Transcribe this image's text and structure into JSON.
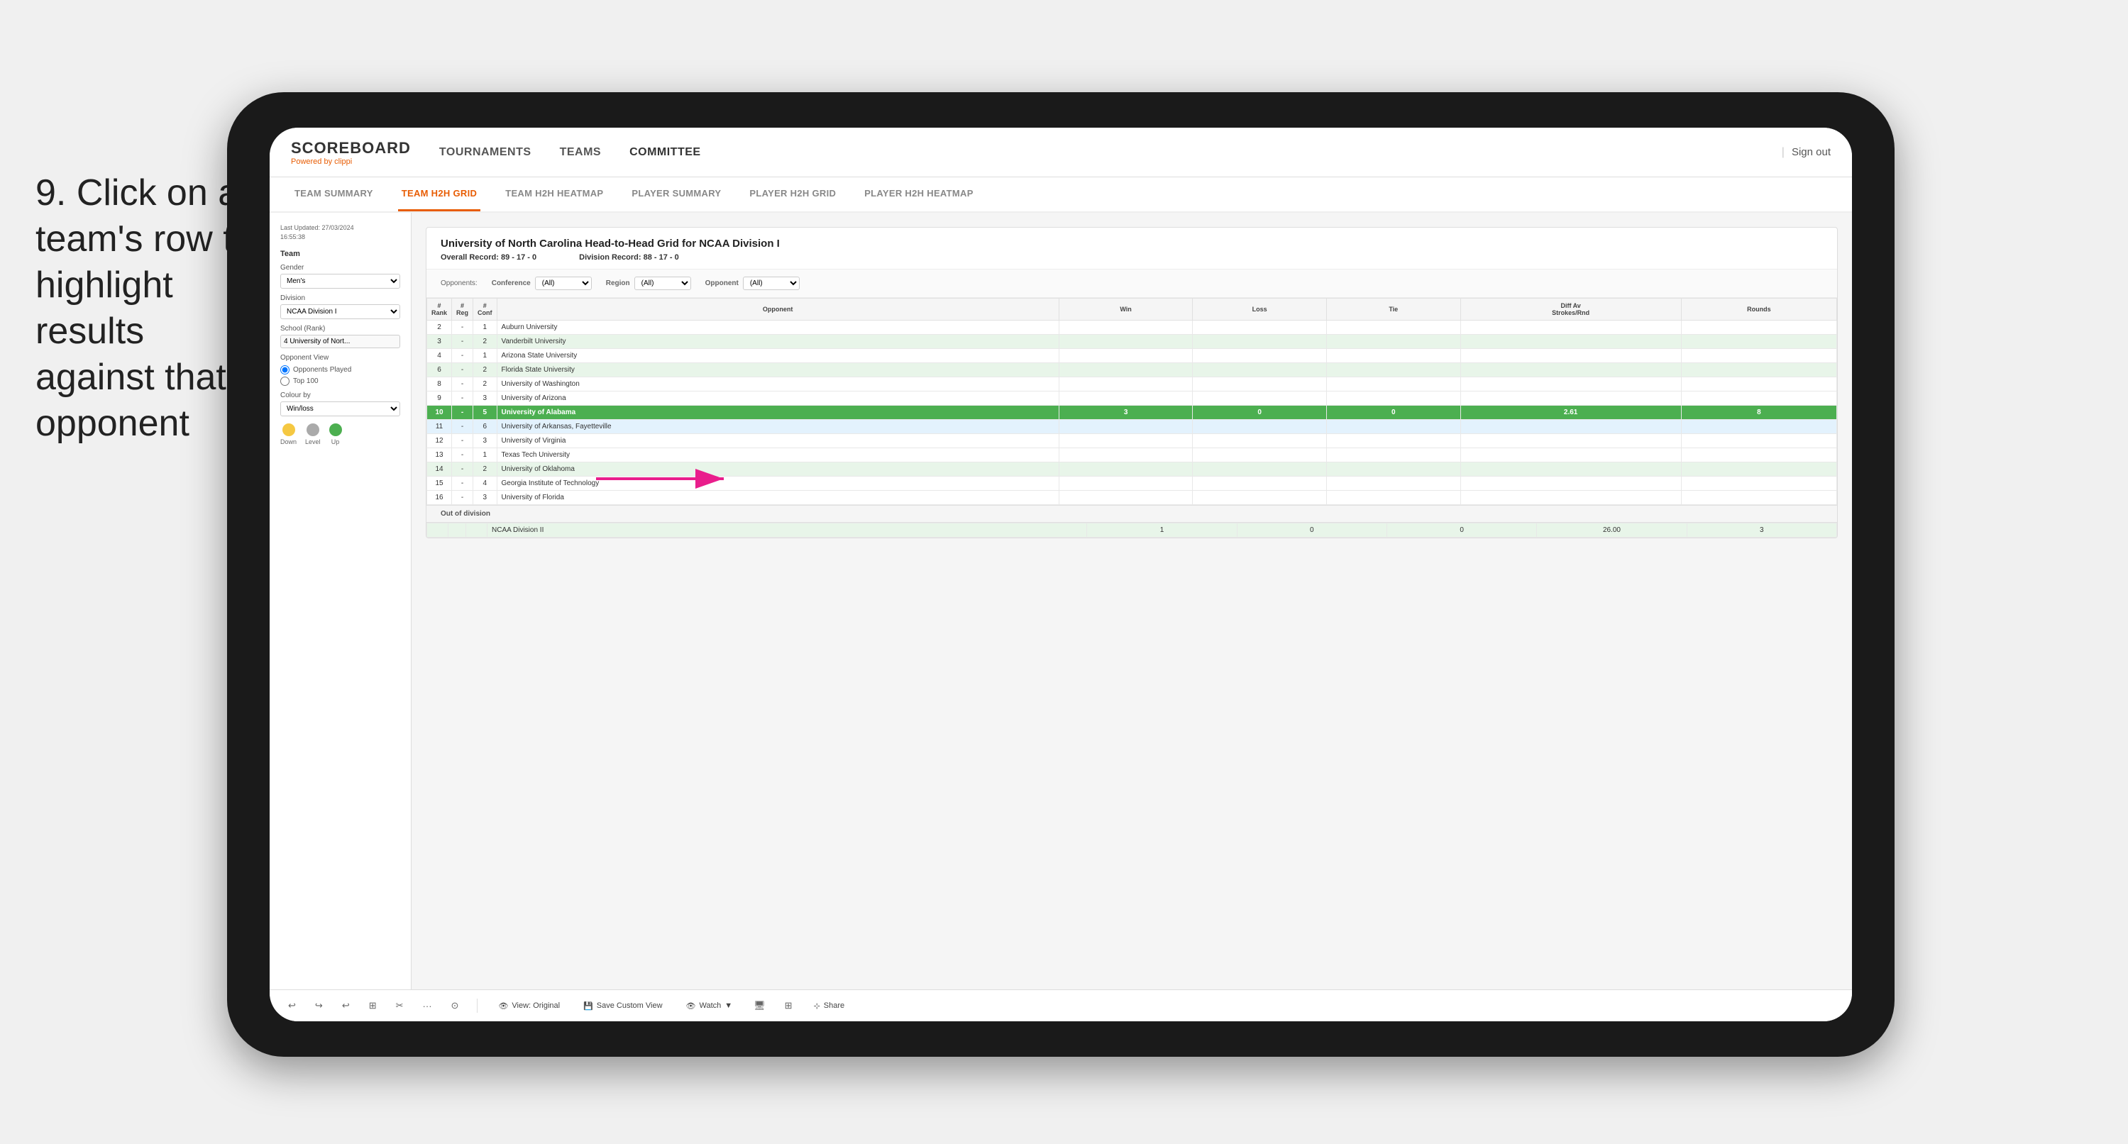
{
  "instruction": {
    "step": "9.",
    "text": "Click on a team's row to highlight results against that opponent"
  },
  "nav": {
    "logo": "SCOREBOARD",
    "powered_by": "Powered by",
    "brand": "clippi",
    "items": [
      {
        "label": "TOURNAMENTS",
        "active": false
      },
      {
        "label": "TEAMS",
        "active": false
      },
      {
        "label": "COMMITTEE",
        "active": true
      }
    ],
    "sign_out": "Sign out"
  },
  "sub_nav": {
    "items": [
      {
        "label": "TEAM SUMMARY",
        "active": false
      },
      {
        "label": "TEAM H2H GRID",
        "active": true
      },
      {
        "label": "TEAM H2H HEATMAP",
        "active": false
      },
      {
        "label": "PLAYER SUMMARY",
        "active": false
      },
      {
        "label": "PLAYER H2H GRID",
        "active": false
      },
      {
        "label": "PLAYER H2H HEATMAP",
        "active": false
      }
    ]
  },
  "sidebar": {
    "timestamp_label": "Last Updated: 27/03/2024",
    "timestamp_time": "16:55:38",
    "team_section": "Team",
    "gender_label": "Gender",
    "gender_value": "Men's",
    "division_label": "Division",
    "division_value": "NCAA Division I",
    "school_label": "School (Rank)",
    "school_value": "4 University of Nort...",
    "opponent_view_label": "Opponent View",
    "opponent_options": [
      {
        "label": "Opponents Played",
        "selected": true
      },
      {
        "label": "Top 100",
        "selected": false
      }
    ],
    "colour_by_label": "Colour by",
    "colour_by_value": "Win/loss",
    "legend": [
      {
        "label": "Down",
        "color": "#f5c842"
      },
      {
        "label": "Level",
        "color": "#999"
      },
      {
        "label": "Up",
        "color": "#4caf50"
      }
    ]
  },
  "panel": {
    "title": "University of North Carolina Head-to-Head Grid for NCAA Division I",
    "overall_record_label": "Overall Record:",
    "overall_record": "89 - 17 - 0",
    "division_record_label": "Division Record:",
    "division_record": "88 - 17 - 0",
    "filters": {
      "opponents_label": "Opponents:",
      "conference_label": "Conference",
      "conference_value": "(All)",
      "region_label": "Region",
      "region_value": "(All)",
      "opponent_label": "Opponent",
      "opponent_value": "(All)"
    },
    "table_headers": [
      "#\nRank",
      "#\nReg",
      "#\nConf",
      "Opponent",
      "Win",
      "Loss",
      "Tie",
      "Diff Av\nStrokes/Rnd",
      "Rounds"
    ],
    "rows": [
      {
        "rank": "2",
        "reg": "-",
        "conf": "1",
        "opponent": "Auburn University",
        "win": "",
        "loss": "",
        "tie": "",
        "diff": "",
        "rounds": "",
        "style": "normal"
      },
      {
        "rank": "3",
        "reg": "-",
        "conf": "2",
        "opponent": "Vanderbilt University",
        "win": "",
        "loss": "",
        "tie": "",
        "diff": "",
        "rounds": "",
        "style": "light-green"
      },
      {
        "rank": "4",
        "reg": "-",
        "conf": "1",
        "opponent": "Arizona State University",
        "win": "",
        "loss": "",
        "tie": "",
        "diff": "",
        "rounds": "",
        "style": "normal"
      },
      {
        "rank": "6",
        "reg": "-",
        "conf": "2",
        "opponent": "Florida State University",
        "win": "",
        "loss": "",
        "tie": "",
        "diff": "",
        "rounds": "",
        "style": "light-green"
      },
      {
        "rank": "8",
        "reg": "-",
        "conf": "2",
        "opponent": "University of Washington",
        "win": "",
        "loss": "",
        "tie": "",
        "diff": "",
        "rounds": "",
        "style": "normal"
      },
      {
        "rank": "9",
        "reg": "-",
        "conf": "3",
        "opponent": "University of Arizona",
        "win": "",
        "loss": "",
        "tie": "",
        "diff": "",
        "rounds": "",
        "style": "normal"
      },
      {
        "rank": "10",
        "reg": "-",
        "conf": "5",
        "opponent": "University of Alabama",
        "win": "3",
        "loss": "0",
        "tie": "0",
        "diff": "2.61",
        "rounds": "8",
        "style": "highlighted"
      },
      {
        "rank": "11",
        "reg": "-",
        "conf": "6",
        "opponent": "University of Arkansas, Fayetteville",
        "win": "",
        "loss": "",
        "tie": "",
        "diff": "",
        "rounds": "",
        "style": "light-blue"
      },
      {
        "rank": "12",
        "reg": "-",
        "conf": "3",
        "opponent": "University of Virginia",
        "win": "",
        "loss": "",
        "tie": "",
        "diff": "",
        "rounds": "",
        "style": "normal"
      },
      {
        "rank": "13",
        "reg": "-",
        "conf": "1",
        "opponent": "Texas Tech University",
        "win": "",
        "loss": "",
        "tie": "",
        "diff": "",
        "rounds": "",
        "style": "normal"
      },
      {
        "rank": "14",
        "reg": "-",
        "conf": "2",
        "opponent": "University of Oklahoma",
        "win": "",
        "loss": "",
        "tie": "",
        "diff": "",
        "rounds": "",
        "style": "light-green"
      },
      {
        "rank": "15",
        "reg": "-",
        "conf": "4",
        "opponent": "Georgia Institute of Technology",
        "win": "",
        "loss": "",
        "tie": "",
        "diff": "",
        "rounds": "",
        "style": "normal"
      },
      {
        "rank": "16",
        "reg": "-",
        "conf": "3",
        "opponent": "University of Florida",
        "win": "",
        "loss": "",
        "tie": "",
        "diff": "",
        "rounds": "",
        "style": "normal"
      }
    ],
    "out_of_division_header": "Out of division",
    "out_division_rows": [
      {
        "label": "NCAA Division II",
        "win": "1",
        "loss": "0",
        "tie": "0",
        "diff": "26.00",
        "rounds": "3"
      }
    ]
  },
  "toolbar": {
    "icons": [
      "↩",
      "↪",
      "↩",
      "⊞",
      "✂",
      "·",
      "⊙"
    ],
    "view_label": "View: Original",
    "save_label": "Save Custom View",
    "watch_label": "Watch",
    "share_label": "Share"
  },
  "colors": {
    "active_nav": "#e85d04",
    "highlight_green": "#4caf50",
    "light_green": "#e8f5e9",
    "light_blue": "#e3f2fd",
    "light_yellow": "#fffde7",
    "row_highlight": "#4caf50"
  }
}
